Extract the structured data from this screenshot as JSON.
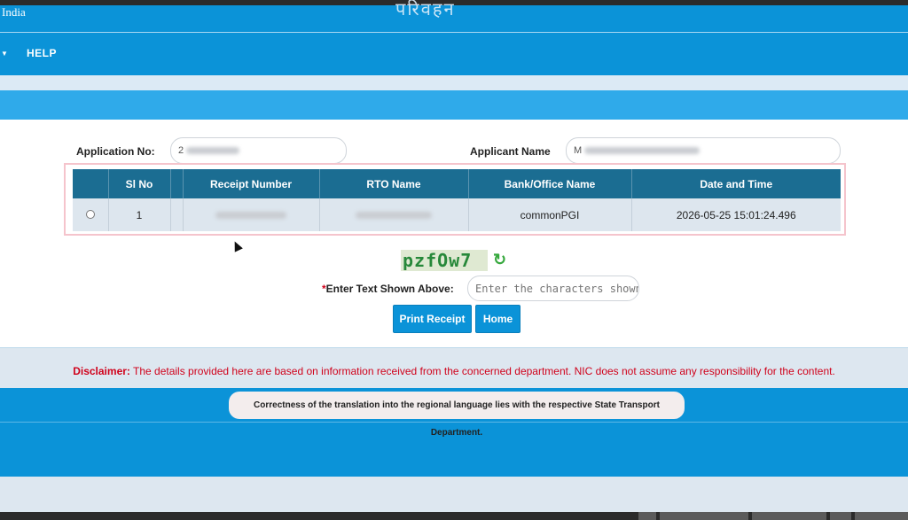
{
  "header": {
    "country": "India",
    "brand": "परिवहन"
  },
  "nav": {
    "help_label": "HELP"
  },
  "form": {
    "application_no_label": "Application No:",
    "application_no_value": "2",
    "applicant_name_label": "Applicant Name",
    "applicant_name_value": "M"
  },
  "table": {
    "columns": [
      "Sl No",
      "Receipt Number",
      "RTO Name",
      "Bank/Office Name",
      "Date and Time"
    ],
    "rows": [
      {
        "sl_no": "1",
        "receipt_number": "",
        "rto_name": "",
        "bank_office_name": "commonPGI",
        "date_time": "2026-05-25 15:01:24.496"
      }
    ]
  },
  "captcha": {
    "text": "pzfOw7",
    "label_required": "*",
    "label": "Enter Text Shown Above:",
    "placeholder": "Enter the characters shown"
  },
  "buttons": {
    "print_receipt": "Print Receipt",
    "home": "Home"
  },
  "disclaimer": {
    "title": "Disclaimer:",
    "text": " The details provided here are based on information received from the concerned department. NIC does not assume any responsibility for the content."
  },
  "translation_note": "Correctness of the translation into the regional language lies with the respective State Transport Department.",
  "colors": {
    "primary_blue": "#0b93d8",
    "table_header": "#1b6d92",
    "disclaimer_red": "#d0021b",
    "captcha_green": "#27883a"
  }
}
